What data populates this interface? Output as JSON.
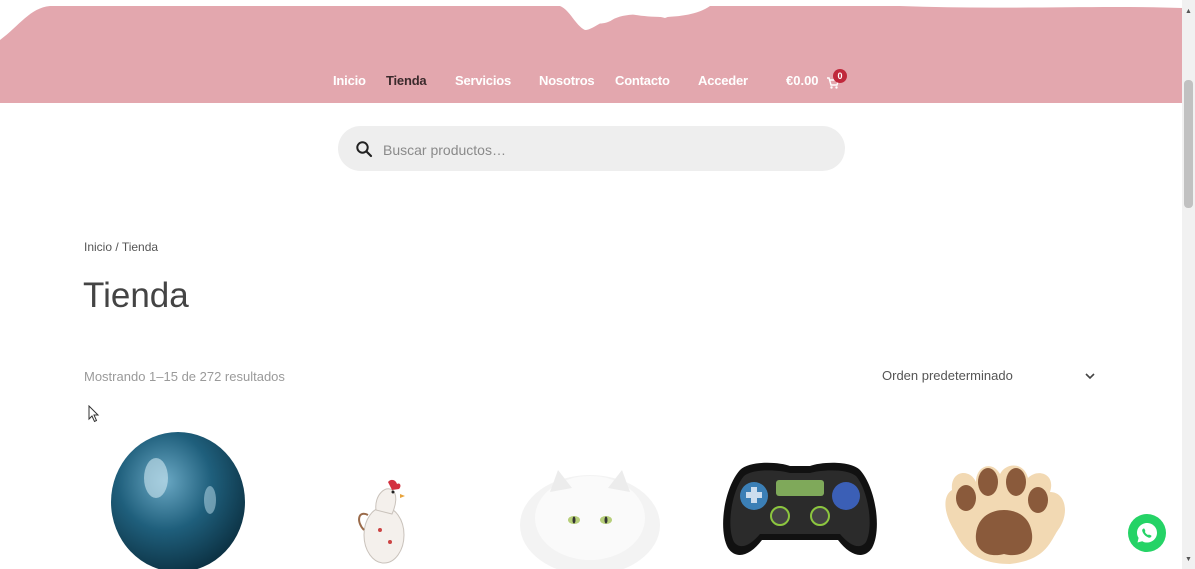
{
  "nav": {
    "items": [
      {
        "label": "Inicio"
      },
      {
        "label": "Tienda"
      },
      {
        "label": "Servicios"
      },
      {
        "label": "Nosotros"
      },
      {
        "label": "Contacto"
      },
      {
        "label": "Acceder"
      }
    ],
    "cart_total": "€0.00",
    "cart_count": "0"
  },
  "search": {
    "placeholder": "Buscar productos…"
  },
  "breadcrumb": {
    "home": "Inicio",
    "separator": "/",
    "current": "Tienda"
  },
  "page_title": "Tienda",
  "result_count": "Mostrando 1–15 de 272 resultados",
  "ordering": {
    "selected": "Orden predeterminado"
  },
  "products": [
    {
      "icon": "blue-balloon-icon"
    },
    {
      "icon": "rooster-balloon-icon"
    },
    {
      "icon": "cat-balloon-icon"
    },
    {
      "icon": "gamepad-balloon-icon"
    },
    {
      "icon": "paw-balloon-icon"
    }
  ],
  "colors": {
    "header": "#e3a7ae",
    "active_nav": "#3b2a2c",
    "badge": "#c0283b",
    "whatsapp": "#25d366"
  }
}
